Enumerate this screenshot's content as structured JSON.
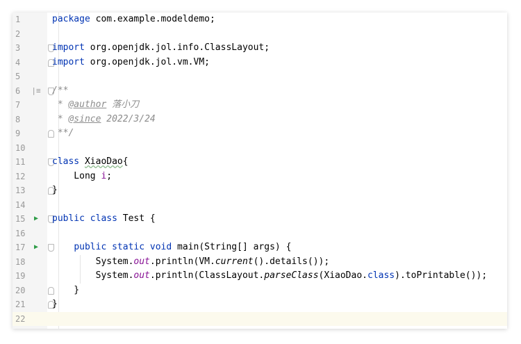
{
  "editor": {
    "current_line": 22,
    "colors": {
      "keyword": "#0033b3",
      "comment": "#8c8c8c",
      "static_member": "#871094",
      "run_marker": "#2e9c47",
      "current_line_bg": "#fcfaed"
    },
    "lines": [
      {
        "n": "1",
        "parts": [
          [
            "kw",
            "package"
          ],
          [
            "p",
            " com.example.modeldemo;"
          ]
        ]
      },
      {
        "n": "2",
        "parts": []
      },
      {
        "n": "3",
        "parts": [
          [
            "kw",
            "import"
          ],
          [
            "p",
            " org.openjdk.jol.info.ClassLayout;"
          ]
        ]
      },
      {
        "n": "4",
        "parts": [
          [
            "kw",
            "import"
          ],
          [
            "p",
            " org.openjdk.jol.vm.VM;"
          ]
        ]
      },
      {
        "n": "5",
        "parts": []
      },
      {
        "n": "6",
        "parts": [
          [
            "cmt",
            "/**"
          ]
        ]
      },
      {
        "n": "7",
        "parts": [
          [
            "cmt",
            " * "
          ],
          [
            "tag",
            "@author"
          ],
          [
            "cmt",
            " 落小刀"
          ]
        ]
      },
      {
        "n": "8",
        "parts": [
          [
            "cmt",
            " * "
          ],
          [
            "tag",
            "@since"
          ],
          [
            "cmt",
            " 2022/3/24"
          ]
        ]
      },
      {
        "n": "9",
        "parts": [
          [
            "cmt",
            " **/"
          ]
        ]
      },
      {
        "n": "10",
        "parts": []
      },
      {
        "n": "11",
        "parts": [
          [
            "kw",
            "class"
          ],
          [
            "p",
            " "
          ],
          [
            "warn",
            "XiaoDao"
          ],
          [
            "p",
            "{"
          ]
        ]
      },
      {
        "n": "12",
        "parts": [
          [
            "p",
            "    Long "
          ],
          [
            "fld",
            "i"
          ],
          [
            "p",
            ";"
          ]
        ]
      },
      {
        "n": "13",
        "parts": [
          [
            "p",
            "}"
          ]
        ]
      },
      {
        "n": "14",
        "parts": []
      },
      {
        "n": "15",
        "parts": [
          [
            "kw",
            "public class"
          ],
          [
            "p",
            " Test {"
          ]
        ]
      },
      {
        "n": "16",
        "parts": []
      },
      {
        "n": "17",
        "parts": [
          [
            "p",
            "    "
          ],
          [
            "kw",
            "public static void"
          ],
          [
            "p",
            " main(String[] args) {"
          ]
        ]
      },
      {
        "n": "18",
        "parts": [
          [
            "p",
            "        System."
          ],
          [
            "st",
            "out"
          ],
          [
            "p",
            ".println(VM."
          ],
          [
            "sm",
            "current"
          ],
          [
            "p",
            "().details());"
          ]
        ]
      },
      {
        "n": "19",
        "parts": [
          [
            "p",
            "        System."
          ],
          [
            "st",
            "out"
          ],
          [
            "p",
            ".println(ClassLayout."
          ],
          [
            "sm",
            "parseClass"
          ],
          [
            "p",
            "(XiaoDao."
          ],
          [
            "kw",
            "class"
          ],
          [
            "p",
            ").toPrintable());"
          ]
        ]
      },
      {
        "n": "20",
        "parts": [
          [
            "p",
            "    }"
          ]
        ]
      },
      {
        "n": "21",
        "parts": [
          [
            "p",
            "}"
          ]
        ]
      },
      {
        "n": "22",
        "parts": []
      }
    ],
    "gutter_markers": [
      {
        "line": 6,
        "icon": "doc-comment-icon",
        "glyph": "|≡"
      },
      {
        "line": 15,
        "icon": "run-class-icon",
        "glyph": "▶"
      },
      {
        "line": 17,
        "icon": "run-method-icon",
        "glyph": "▶"
      }
    ],
    "folds": [
      {
        "line": 3,
        "type": "start"
      },
      {
        "line": 4,
        "type": "end"
      },
      {
        "line": 6,
        "type": "start"
      },
      {
        "line": 9,
        "type": "end"
      },
      {
        "line": 11,
        "type": "start"
      },
      {
        "line": 13,
        "type": "end"
      },
      {
        "line": 15,
        "type": "start"
      },
      {
        "line": 17,
        "type": "start"
      },
      {
        "line": 20,
        "type": "end"
      },
      {
        "line": 21,
        "type": "end"
      }
    ]
  }
}
